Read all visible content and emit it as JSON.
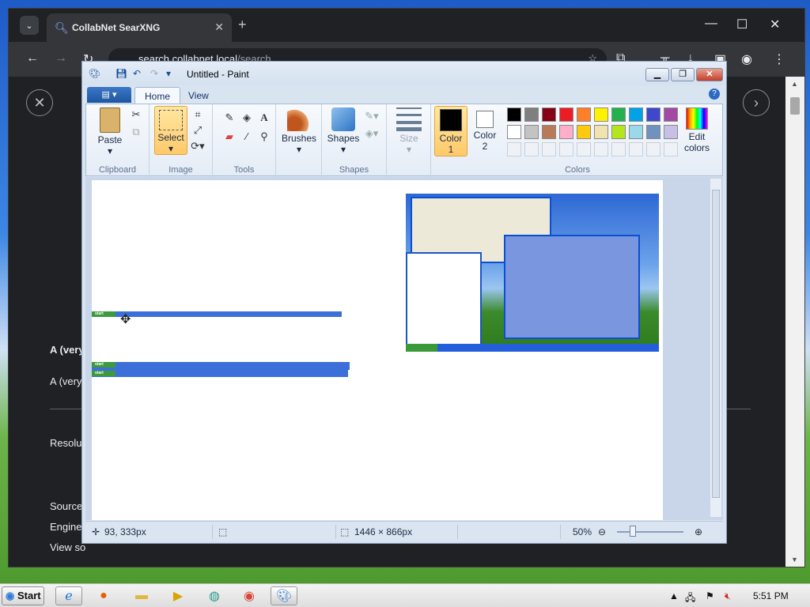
{
  "browser": {
    "tab_title": "CollabNet SearXNG",
    "url_host": "search.collabnet.local",
    "url_path": "/search",
    "page": {
      "heading": "A (very",
      "subtext": "A (very",
      "label_resolution": "Resolu",
      "label_source": "Source",
      "label_engine": "Engine",
      "label_view": "View so"
    }
  },
  "paint": {
    "title": "Untitled - Paint",
    "tabs": [
      "Home",
      "View"
    ],
    "groups": {
      "clipboard": "Clipboard",
      "image": "Image",
      "tools": "Tools",
      "shapes": "Shapes",
      "colors": "Colors"
    },
    "buttons": {
      "paste": "Paste",
      "select": "Select",
      "brushes": "Brushes",
      "shapes": "Shapes",
      "size": "Size",
      "color1": "Color\n1",
      "color1_a": "Color",
      "color1_b": "1",
      "color2_a": "Color",
      "color2_b": "2",
      "edit_a": "Edit",
      "edit_b": "colors"
    },
    "palette_row1": [
      "#000000",
      "#7f7f7f",
      "#880015",
      "#ed1c24",
      "#ff7f27",
      "#fff200",
      "#22b14c",
      "#00a2e8",
      "#3f48cc",
      "#a349a4"
    ],
    "palette_row2": [
      "#ffffff",
      "#c3c3c3",
      "#b97a57",
      "#ffaec9",
      "#ffc90e",
      "#efe4b0",
      "#b5e61d",
      "#99d9ea",
      "#7092be",
      "#c8bfe7"
    ],
    "color1": "#000000",
    "color2": "#ffffff",
    "status": {
      "cursor": "93, 333px",
      "image_size": "1446 × 866px",
      "zoom": "50%"
    },
    "canvas_start_label": "start"
  },
  "taskbar": {
    "start": "Start",
    "clock": "5:51 PM"
  }
}
